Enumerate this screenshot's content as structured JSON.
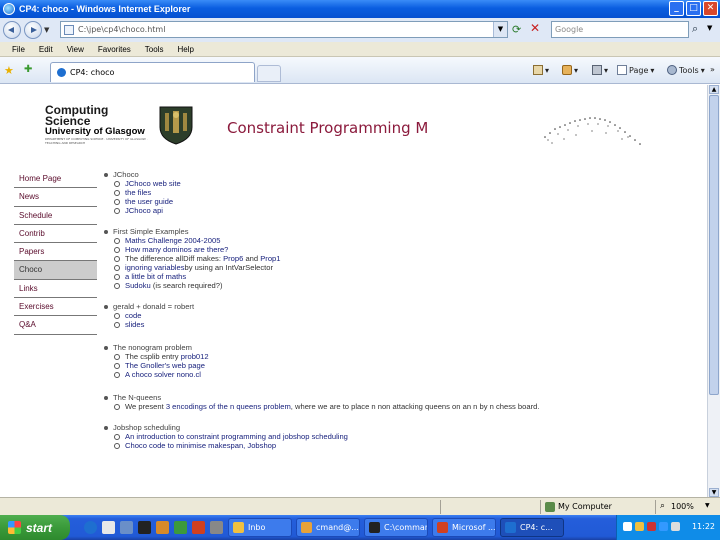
{
  "window": {
    "title": "CP4: choco - Windows Internet Explorer",
    "minimize": "_",
    "maximize": "□",
    "close": "✕"
  },
  "address": {
    "url": "C:\\jpe\\cp4\\choco.html",
    "search_placeholder": "Google"
  },
  "menu": [
    "File",
    "Edit",
    "View",
    "Favorites",
    "Tools",
    "Help"
  ],
  "tabbar": {
    "tab_label": "CP4: choco",
    "page_label": "Page",
    "tools_label": "Tools",
    "more_label": "»"
  },
  "page": {
    "logo": {
      "line1": "Computing",
      "line2": "Science",
      "line3": "University of Glasgow",
      "fine_print": "DEPARTMENT OF COMPUTING SCIENCE · UNIVERSITY OF GLASGOW · TEACHING AND RESEARCH"
    },
    "title": "Constraint Programming M",
    "sidenav": [
      {
        "label": "Home Page",
        "active": false
      },
      {
        "label": "News",
        "active": false
      },
      {
        "label": "Schedule",
        "active": false
      },
      {
        "label": "Contrib",
        "active": false
      },
      {
        "label": "Papers",
        "active": false
      },
      {
        "label": "Choco",
        "active": true
      },
      {
        "label": "Links",
        "active": false
      },
      {
        "label": "Exercises",
        "active": false
      },
      {
        "label": "Q&A",
        "active": false
      }
    ],
    "sections": [
      {
        "title": "JChoco",
        "items": [
          [
            {
              "t": "JChoco web site",
              "link": true
            }
          ],
          [
            {
              "t": "the files",
              "link": true
            }
          ],
          [
            {
              "t": "the user guide",
              "link": true
            }
          ],
          [
            {
              "t": "JChoco api",
              "link": true
            }
          ]
        ]
      },
      {
        "title": "First Simple Examples",
        "items": [
          [
            {
              "t": "Maths Challenge 2004-2005",
              "link": true
            }
          ],
          [
            {
              "t": "How many dominos are there?",
              "link": true
            }
          ],
          [
            {
              "t": "The difference allDiff makes: ",
              "link": false
            },
            {
              "t": "Prop6",
              "link": true
            },
            {
              "t": " and ",
              "link": false
            },
            {
              "t": "Prop1",
              "link": true
            }
          ],
          [
            {
              "t": "ignoring variables",
              "link": true
            },
            {
              "t": "by using an IntVarSelector",
              "link": false
            }
          ],
          [
            {
              "t": "a little bit of maths",
              "link": true
            }
          ],
          [
            {
              "t": "Sudoku",
              "link": true
            },
            {
              "t": " (is search required?)",
              "link": false
            }
          ]
        ]
      },
      {
        "title": "gerald + donald = robert",
        "items": [
          [
            {
              "t": "code",
              "link": true
            }
          ],
          [
            {
              "t": "slides",
              "link": true
            }
          ]
        ]
      },
      {
        "title": "The nonogram problem",
        "items": [
          [
            {
              "t": "The csplib entry ",
              "link": false
            },
            {
              "t": "prob012",
              "link": true
            }
          ],
          [
            {
              "t": "The Gnoller's web page",
              "link": true
            }
          ],
          [
            {
              "t": "A choco solver nono.cl",
              "link": true
            }
          ]
        ]
      },
      {
        "title": "The N-queens",
        "items": [
          [
            {
              "t": "We present ",
              "link": false
            },
            {
              "t": "3 encodings of the n queens problem",
              "link": true
            },
            {
              "t": ", where we are to place n non attacking queens on an n by n chess board.",
              "link": false
            }
          ]
        ]
      },
      {
        "title": "Jobshop scheduling",
        "items": [
          [
            {
              "t": "An introduction to constraint programming and jobshop scheduling",
              "link": true
            }
          ],
          [
            {
              "t": "Choco code to minimise makespan, Jobshop",
              "link": true
            }
          ]
        ]
      }
    ]
  },
  "status": {
    "zone": "My Computer",
    "zoom": "100%"
  },
  "taskbar": {
    "start": "start",
    "buttons": [
      {
        "label": "Inbo",
        "color": "#f0c040"
      },
      {
        "label": "cmand@...",
        "color": "#e8a23a"
      },
      {
        "label": "C:\\comman...",
        "color": "#222222"
      },
      {
        "label": "Microsof ...",
        "color": "#d04020"
      },
      {
        "label": "CP4: c...",
        "color": "#1e6fd0",
        "active": true
      }
    ],
    "clock": "11:22"
  }
}
